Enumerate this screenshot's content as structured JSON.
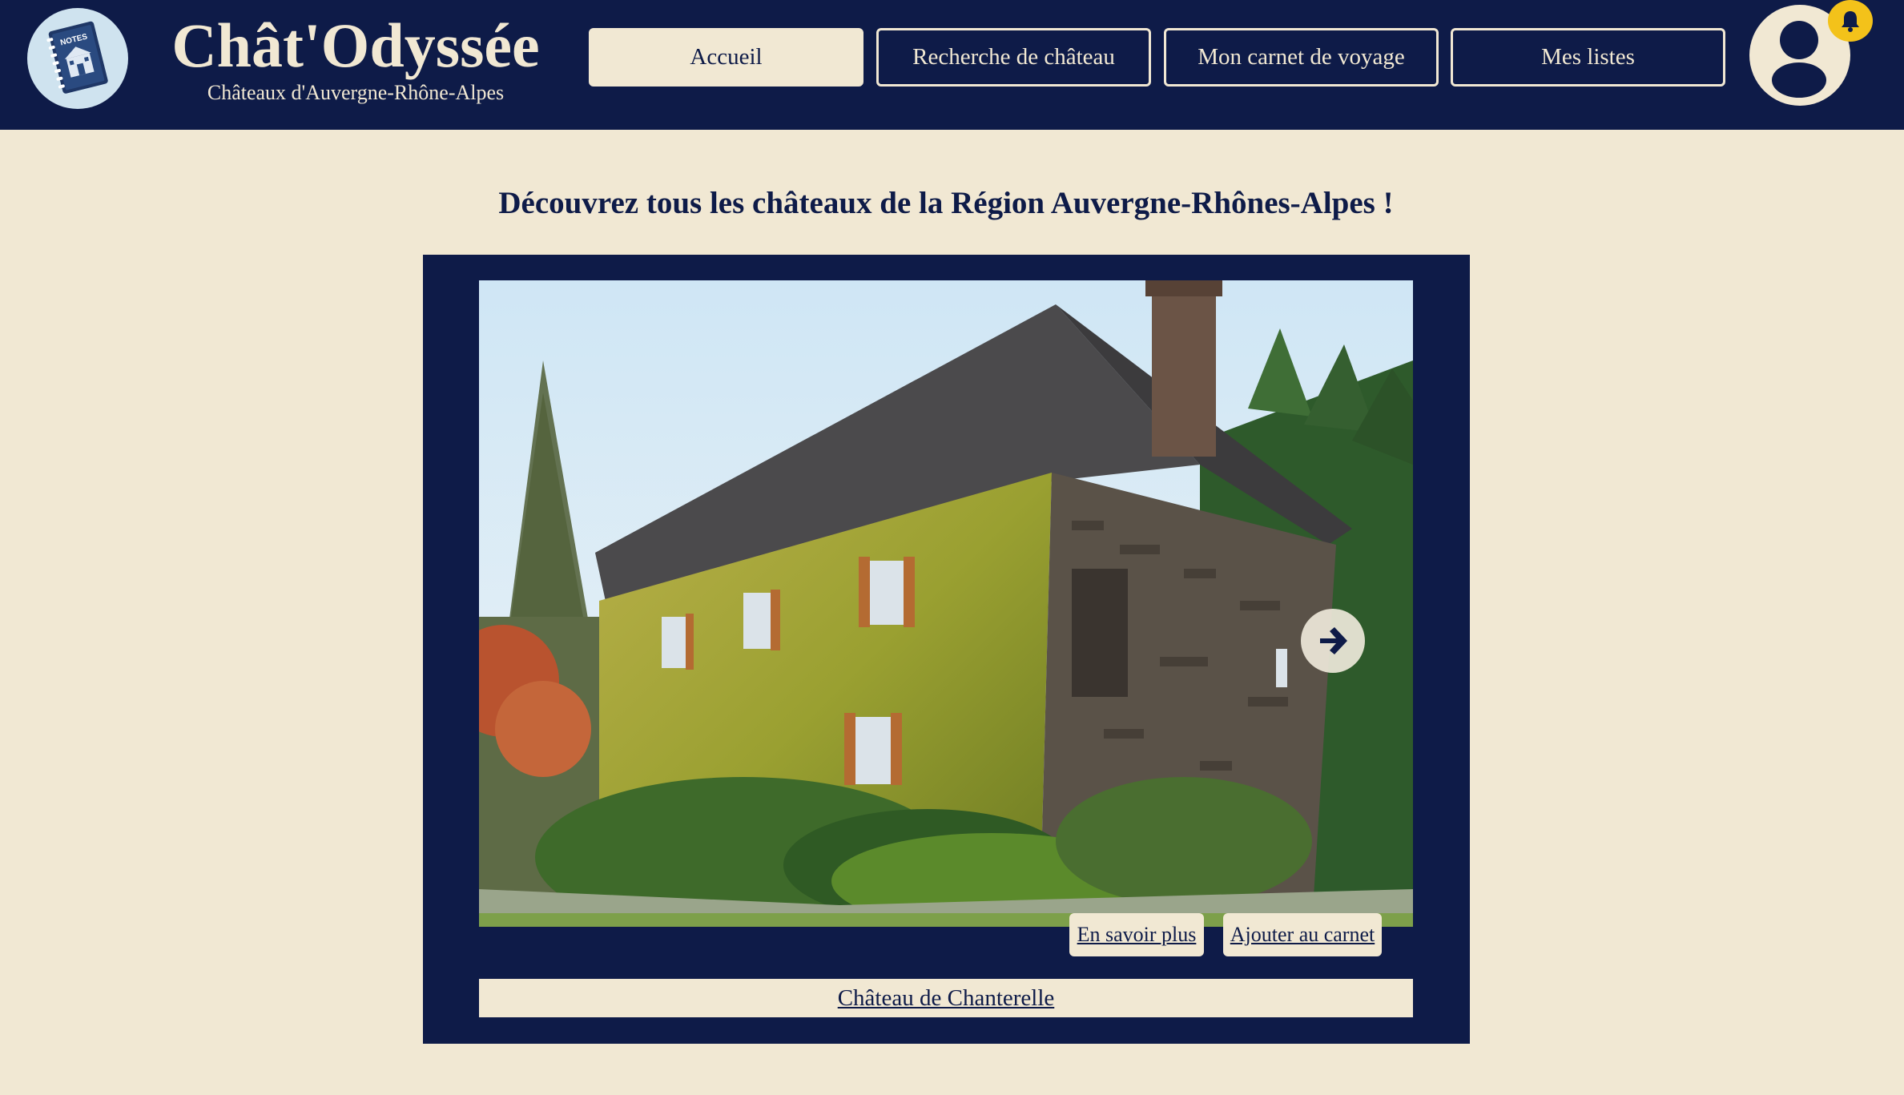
{
  "header": {
    "logo_icon": "notebook-icon",
    "logo_text": "NOTES",
    "title": "Chât'Odyssée",
    "subtitle": "Châteaux d'Auvergne-Rhône-Alpes",
    "nav": [
      {
        "label": "Accueil",
        "active": true
      },
      {
        "label": "Recherche de château",
        "active": false
      },
      {
        "label": "Mon carnet de voyage",
        "active": false
      },
      {
        "label": "Mes listes",
        "active": false
      }
    ],
    "avatar_icon": "user-icon",
    "notification_icon": "bell-icon"
  },
  "main": {
    "headline": "Découvrez tous les châteaux de la Région Auvergne-Rhônes-Alpes !",
    "carousel": {
      "next_icon": "arrow-right-icon",
      "more_label": "En savoir plus",
      "add_label": "Ajouter au carnet",
      "caption": "Château de Chanterelle"
    }
  },
  "colors": {
    "navy": "#0e1b48",
    "cream": "#f1e8d3",
    "bell_yellow": "#f3c21a"
  }
}
